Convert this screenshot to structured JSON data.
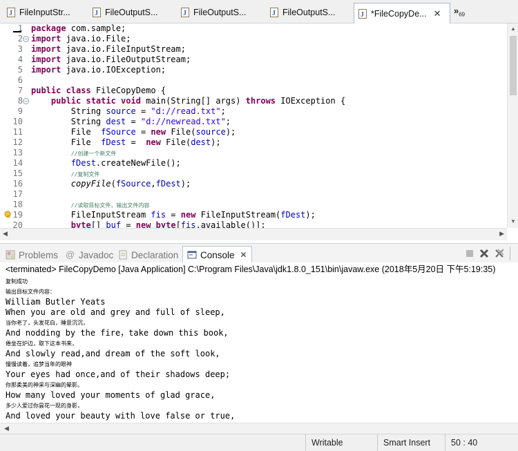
{
  "editor_tabs": [
    {
      "label": "FileInputStr...",
      "active": false
    },
    {
      "label": "FileOutputS...",
      "active": false
    },
    {
      "label": "FileOutputS...",
      "active": false
    },
    {
      "label": "FileOutputS...",
      "active": false
    },
    {
      "label": "*FileCopyDe...",
      "active": true
    }
  ],
  "overflow": {
    "glyph": "»",
    "count": "69"
  },
  "code_lines": [
    {
      "n": "1",
      "html": "<span class=\"kw\">package</span> com.sample;"
    },
    {
      "n": "2",
      "fold": true,
      "html": "<span class=\"kw\">import</span> java.io.File;"
    },
    {
      "n": "3",
      "html": "<span class=\"kw\">import</span> java.io.FileInputStream;"
    },
    {
      "n": "4",
      "html": "<span class=\"kw\">import</span> java.io.FileOutputStream;"
    },
    {
      "n": "5",
      "html": "<span class=\"kw\">import</span> java.io.IOException;"
    },
    {
      "n": "6",
      "html": ""
    },
    {
      "n": "7",
      "html": "<span class=\"kw\">public class</span> FileCopyDemo {"
    },
    {
      "n": "8",
      "fold": true,
      "html": "    <span class=\"kw\">public static void</span> main(String[] args) <span class=\"kw\">throws</span> IOException {"
    },
    {
      "n": "9",
      "html": "        String <span class=\"fld\">source</span> = <span class=\"str\">\"d://read.txt\"</span>;"
    },
    {
      "n": "10",
      "html": "        String <span class=\"fld\">dest</span> = <span class=\"str\">\"d://newread.txt\"</span>;"
    },
    {
      "n": "11",
      "html": "        File  <span class=\"fld\">fSource</span> = <span class=\"kw\">new</span> File(<span class=\"fld\">source</span>);"
    },
    {
      "n": "12",
      "html": "        File  <span class=\"fld\">fDest</span> =  <span class=\"kw\">new</span> File(<span class=\"fld\">dest</span>);"
    },
    {
      "n": "13",
      "html": "        <span class=\"cmt\">//创建一个新文件</span>"
    },
    {
      "n": "14",
      "html": "        <span class=\"fld\">fDest</span>.createNewFile();"
    },
    {
      "n": "15",
      "html": "        <span class=\"cmt\">//复制文件</span>"
    },
    {
      "n": "16",
      "html": "        <span class=\"it\">copyFile</span>(<span class=\"fld\">fSource</span>,<span class=\"fld\">fDest</span>);"
    },
    {
      "n": "17",
      "html": ""
    },
    {
      "n": "18",
      "html": "        <span class=\"cmt\">//读取目标文件，输出文件内容</span>"
    },
    {
      "n": "19",
      "warn": true,
      "html": "        FileInputStream <span class=\"fld\">fis</span> = <span class=\"kw\">new</span> FileInputStream(<span class=\"fld\">fDest</span>);"
    },
    {
      "n": "20",
      "html": "        <span class=\"kw\">byte</span>[] <span class=\"fld\">buf</span> = <span class=\"kw\">new byte</span>[<span class=\"fld\">fis</span>.available()];"
    }
  ],
  "view_tabs": {
    "problems": "Problems",
    "javadoc": "Javadoc",
    "declaration": "Declaration",
    "console": "Console"
  },
  "console": {
    "header": "<terminated> FileCopyDemo [Java Application] C:\\Program Files\\Java\\jdk1.8.0_151\\bin\\javaw.exe (2018年5月20日 下午5:19:35)",
    "lines": [
      {
        "text": "复制成功",
        "cn": true
      },
      {
        "text": "输出目标文件内容：",
        "cn": true
      },
      {
        "text": "William Butler Yeats",
        "cn": false
      },
      {
        "text": "When you are old and grey and full of sleep,",
        "cn": false
      },
      {
        "text": "当你老了，头发花白，睡意沉沉，",
        "cn": true
      },
      {
        "text": "And nodding by the fire，take down this book,",
        "cn": false
      },
      {
        "text": "倦坐在炉边，取下这本书来，",
        "cn": true
      },
      {
        "text": "And slowly read,and dream of the soft look,",
        "cn": false
      },
      {
        "text": "慢慢读着，追梦当年的眼神",
        "cn": true
      },
      {
        "text": "Your eyes had once,and of their shadows deep;",
        "cn": false
      },
      {
        "text": "你那柔美的神采与深幽的晕影。",
        "cn": true
      },
      {
        "text": "How many loved your moments of glad grace,",
        "cn": false
      },
      {
        "text": "多少人爱过你昙花一现的身影，",
        "cn": true
      },
      {
        "text": "And loved your beauty with love false or true,",
        "cn": false
      }
    ]
  },
  "status": {
    "writable": "Writable",
    "insert_mode": "Smart Insert",
    "position": "50 : 40"
  },
  "colors": {
    "keyword": "#7f0055",
    "string": "#2a00ff",
    "field": "#0000c0",
    "comment": "#3f7f5f"
  }
}
